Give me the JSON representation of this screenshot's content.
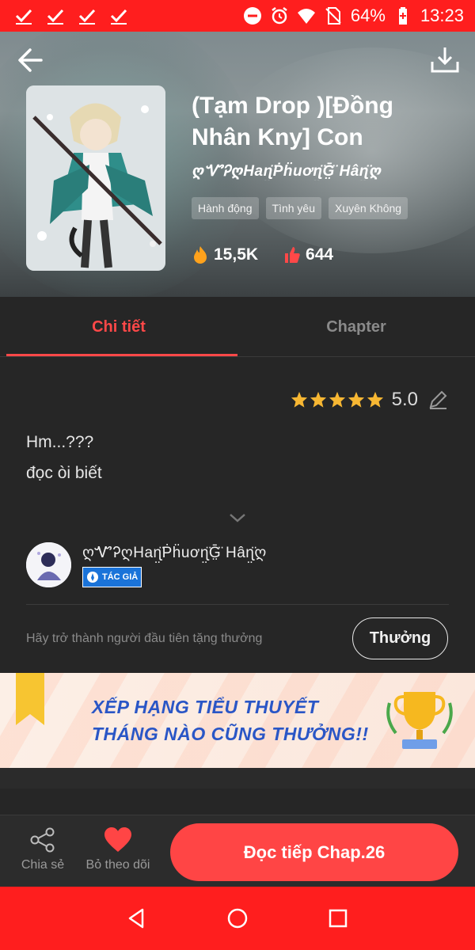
{
  "status_bar": {
    "battery": "64%",
    "time": "13:23",
    "icons": [
      "check-icon",
      "check-icon",
      "check-icon",
      "check-icon",
      "dnd-icon",
      "alarm-icon",
      "wifi-icon",
      "no-sim-icon",
      "battery-icon"
    ]
  },
  "header": {
    "title": "(Tạm Drop )[Đồng Nhân Kny] Con",
    "author": "ღᏉᎮღHaɳ̤̈Ṗḧuơɳ̤̈Ḡ̤̈ Hâɳ̤̈ღ",
    "tags": [
      "Hành động",
      "Tình yêu",
      "Xuyên Không"
    ],
    "views": "15,5K",
    "likes": "644"
  },
  "tabs": [
    {
      "label": "Chi tiết",
      "active": true
    },
    {
      "label": "Chapter",
      "active": false
    }
  ],
  "detail": {
    "rating": "5.0",
    "description_lines": [
      "Hm...???",
      "đọc òi biết"
    ],
    "author_name": "ღᏉᎮღHaɳ̤̈Ṗḧuơɳ̤̈Ḡ̤̈ Hâɳ̤̈ღ",
    "author_badge": "TÁC GIẢ",
    "gift_prompt": "Hãy trở thành người đầu tiên tặng thưởng",
    "reward_label": "Thưởng"
  },
  "banner": {
    "line1": "XẾP HẠNG TIỂU THUYẾT",
    "line2": "THÁNG NÀO CŨNG THƯỞNG!!"
  },
  "bottom_bar": {
    "share_label": "Chia sẻ",
    "follow_label": "Bỏ theo dõi",
    "read_label": "Đọc tiếp Chap.26"
  },
  "colors": {
    "accent": "#ff4545",
    "status_bar": "#ff1e1e",
    "background": "#262626"
  }
}
